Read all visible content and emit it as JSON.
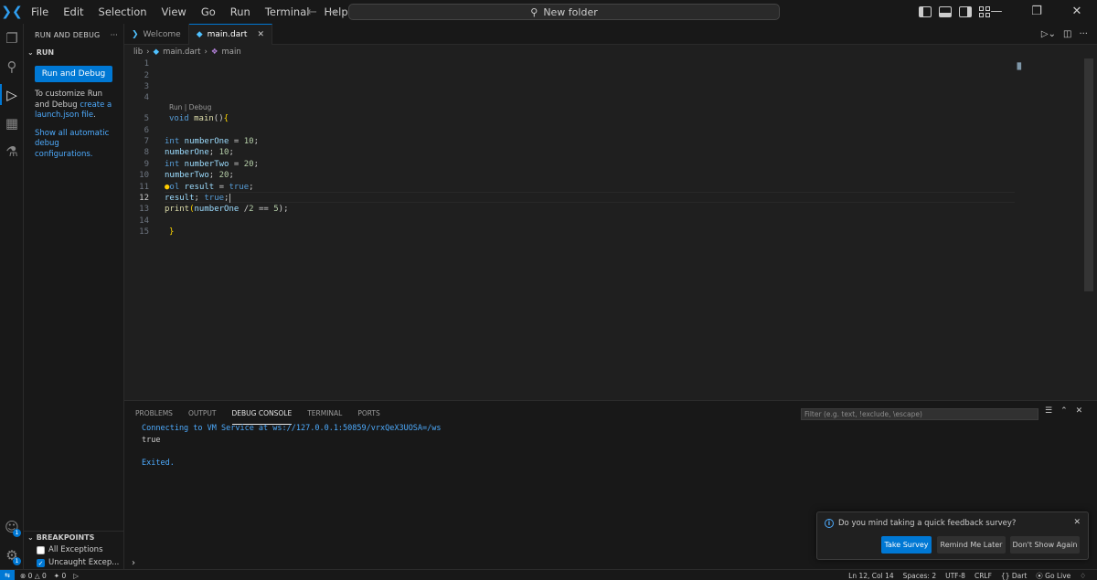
{
  "titlebar": {
    "logo": "vscode-logo",
    "menu": [
      "File",
      "Edit",
      "Selection",
      "View",
      "Go",
      "Run",
      "Terminal",
      "Help"
    ],
    "search_text": "New folder"
  },
  "activity_icons": [
    "explorer-icon",
    "search-icon",
    "run-debug-icon",
    "extensions-icon",
    "testing-icon"
  ],
  "activity_bottom": {
    "account_badge": "1",
    "settings_badge": "1"
  },
  "sidebar": {
    "title": "RUN AND DEBUG",
    "section": "RUN",
    "run_button": "Run and Debug",
    "customize_text": "To customize Run and Debug",
    "customize_link": "create a launch.json file",
    "customize_end": ".",
    "show_all_link": "Show all automatic debug configurations.",
    "breakpoints_title": "BREAKPOINTS",
    "breakpoints": [
      {
        "label": "All Exceptions",
        "checked": false
      },
      {
        "label": "Uncaught Excep...",
        "checked": true
      }
    ]
  },
  "tabs": [
    {
      "label": "Welcome",
      "active": false
    },
    {
      "label": "main.dart",
      "active": true
    }
  ],
  "breadcrumb": {
    "folder": "lib",
    "file": "main.dart",
    "symbol": "main"
  },
  "editor": {
    "codelens": "Run | Debug",
    "line_numbers": [
      "1",
      "2",
      "3",
      "4",
      "5",
      "6",
      "7",
      "8",
      "9",
      "10",
      "11",
      "12",
      "13",
      "14",
      "15"
    ],
    "current_line": "12",
    "lines": {
      "l5a": "void",
      "l5b": " main",
      "l5c": "()",
      "l5d": "{",
      "l7a": "int",
      "l7b": " numberOne",
      "l7c": " = ",
      "l7d": "10",
      "l7e": ";",
      "l8a": "numberOne",
      "l8b": "; ",
      "l8c": "10",
      "l8d": ";",
      "l9a": "int",
      "l9b": " numberTwo",
      "l9c": " = ",
      "l9d": "20",
      "l9e": ";",
      "l10a": "numberTwo",
      "l10b": "; ",
      "l10c": "20",
      "l10d": ";",
      "l11a": "ol",
      "l11b": " result",
      "l11c": " = ",
      "l11d": "true",
      "l11e": ";",
      "l12a": "result",
      "l12b": "; ",
      "l12c": "true",
      "l12d": ";",
      "l13a": "print",
      "l13b": "(",
      "l13c": "numberOne",
      "l13d": " /",
      "l13e": "2",
      "l13f": " == ",
      "l13g": "5",
      "l13h": ");",
      "l15a": "}"
    }
  },
  "panel": {
    "tabs": [
      "PROBLEMS",
      "OUTPUT",
      "DEBUG CONSOLE",
      "TERMINAL",
      "PORTS"
    ],
    "active_tab": "DEBUG CONSOLE",
    "filter_placeholder": "Filter (e.g. text, !exclude, \\escape)",
    "console_lines": [
      "Connecting to VM Service at ws://127.0.0.1:50859/vrxQeX3UOSA=/ws",
      "true",
      "",
      "Exited."
    ]
  },
  "notification": {
    "message": "Do you mind taking a quick feedback survey?",
    "buttons": [
      "Take Survey",
      "Remind Me Later",
      "Don't Show Again"
    ]
  },
  "statusbar": {
    "errors": "0",
    "warnings": "0",
    "ports": "0",
    "position": "Ln 12, Col 14",
    "spaces": "Spaces: 2",
    "encoding": "UTF-8",
    "eol": "CRLF",
    "language": "Dart",
    "golive": "Go Live"
  },
  "colors": {
    "accent": "#0078d4",
    "link": "#4daafc",
    "keyword": "#569cd6",
    "function": "#dcdcaa",
    "variable": "#9cdcfe",
    "number": "#b5cea8"
  }
}
